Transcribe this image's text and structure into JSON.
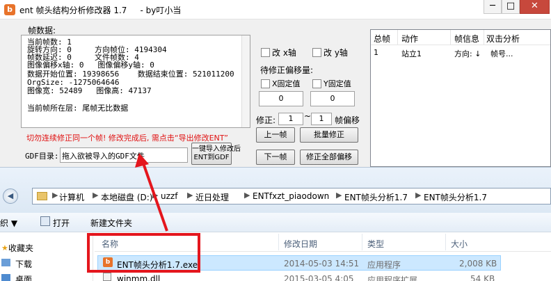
{
  "app": {
    "icon_glyph": "b",
    "title": "ent 帧头结构分析修改器 1.7     - by叮小当",
    "window_buttons": {
      "minimize": "─",
      "maximize": "□",
      "close": "✕"
    },
    "frame_data": {
      "label": "帧数据:",
      "lines": [
        "当前帧数: 1",
        "旋转方向: 0     方向帧位: 4194304",
        "帧数延迟: 0     文件帧数: 4",
        "图像偏移x轴: 0   图像偏移y轴: 0",
        "数据开始位置: 19398656    数据结束位置: 521011200",
        "OrgSize: -1275064646",
        "图像宽: 52489   图像高: 47137",
        "",
        "当前帧所在层: 尾帧无比数据"
      ]
    },
    "warning": "切勿连续修正同一个帧! 修改完成后, 需点击“导出修改ENT”",
    "gdf": {
      "label": "GDF目录:",
      "value": "拖入欲被导入的GDF文件",
      "import_button": "一键导入修改后\nENT到GDF"
    },
    "controls": {
      "flip_x": "改 x轴",
      "flip_y": "改 y轴",
      "offset_label": "待修正偏移量:",
      "fixed_x": "X固定值",
      "fixed_y": "Y固定值",
      "value_x": "0",
      "value_y": "0",
      "fix_label": "修正:",
      "fix_from": "1",
      "tilde": "~",
      "fix_to": "1",
      "fix_suffix": "帧偏移",
      "prev_button": "上一帧",
      "batch_button": "批量修正",
      "next_button": "下一帧",
      "fixall_button": "修正全部偏移"
    },
    "list": {
      "headers": [
        "总帧",
        "动作",
        "帧信息",
        "双击分析"
      ],
      "rows": [
        [
          "1",
          "站立1",
          "方向: ↓",
          "帧号..."
        ]
      ]
    }
  },
  "explorer": {
    "back_icon": "◀",
    "breadcrumb": [
      "计算机",
      "本地磁盘 (D:)",
      "uzzf",
      "近日处理",
      "ENTfxzt_piaodown",
      "ENT帧头分析1.7",
      "ENT帧头分析1.7"
    ],
    "crumb_sep": "▶",
    "toolbar": {
      "organize": "织 ▼",
      "open": "打开",
      "new_folder": "新建文件夹"
    },
    "sidebar": {
      "favorites": "收藏夹",
      "downloads": "下载",
      "desktop": "桌面"
    },
    "columns": [
      "名称",
      "修改日期",
      "类型",
      "大小"
    ],
    "files": [
      {
        "name": "ENT帧头分析1.7.exe",
        "date": "2014-05-03 14:51",
        "type": "应用程序",
        "size": "2,008 KB"
      },
      {
        "name": "winmm.dll",
        "date": "2015-03-05 4:05",
        "type": "应用程序扩展",
        "size": "54 KB"
      }
    ]
  },
  "colors": {
    "highlight": "#e4161d",
    "selection": "#cce8ff",
    "warning": "#e01010"
  }
}
